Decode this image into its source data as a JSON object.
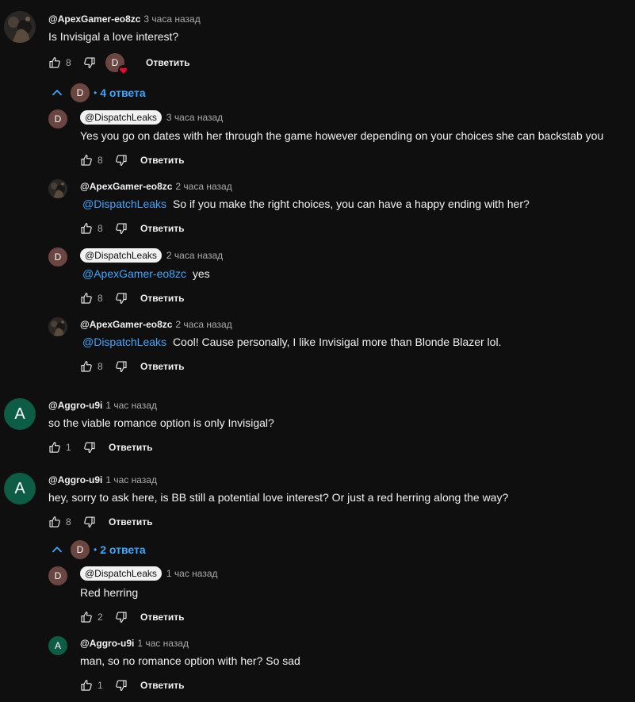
{
  "reply_label": "Ответить",
  "thread1": {
    "top": {
      "author": "@ApexGamer-eo8zc",
      "time": "3 часа назад",
      "text": "Is Invisigal a love interest?",
      "likes": "8",
      "heart_avatar": "D"
    },
    "toggle": {
      "avatar": "D",
      "dot": "•",
      "label": "4 ответа"
    },
    "replies": [
      {
        "author": "@DispatchLeaks",
        "avatar": "D",
        "time": "3 часа назад",
        "mention": "",
        "text": "Yes you go on dates with her through the game however depending on your choices she can backstab you",
        "likes": "8"
      },
      {
        "author": "@ApexGamer-eo8zc",
        "avatar": "",
        "time": "2 часа назад",
        "mention": "@DispatchLeaks",
        "text": "So if you make the right choices, you can have a happy ending with her?",
        "likes": "8"
      },
      {
        "author": "@DispatchLeaks",
        "avatar": "D",
        "time": "2 часа назад",
        "mention": "@ApexGamer-eo8zc",
        "text": "yes",
        "likes": "8"
      },
      {
        "author": "@ApexGamer-eo8zc",
        "avatar": "",
        "time": "2 часа назад",
        "mention": "@DispatchLeaks",
        "text": "Cool! Cause personally, I like Invisigal more than Blonde Blazer lol.",
        "likes": "8"
      }
    ]
  },
  "comment2": {
    "author": "@Aggro-u9i",
    "avatar": "A",
    "time": "1 час назад",
    "text": "so the viable romance option is only Invisigal?",
    "likes": "1"
  },
  "thread3": {
    "top": {
      "author": "@Aggro-u9i",
      "avatar": "A",
      "time": "1 час назад",
      "text": "hey, sorry to ask here, is BB still a potential love interest? Or just a red herring along the way?",
      "likes": "8"
    },
    "toggle": {
      "avatar": "D",
      "dot": "•",
      "label": "2 ответа"
    },
    "replies": [
      {
        "author": "@DispatchLeaks",
        "avatar": "D",
        "time": "1 час назад",
        "text": "Red herring",
        "likes": "2"
      },
      {
        "author": "@Aggro-u9i",
        "avatar": "A",
        "time": "1 час назад",
        "text": "man, so no romance option with her? So sad",
        "likes": "1"
      }
    ]
  },
  "colors": {
    "background": "#0f0f0f",
    "link": "#3ea6ff",
    "avatar_d": "#6b4640",
    "avatar_a": "#0d5c45"
  }
}
